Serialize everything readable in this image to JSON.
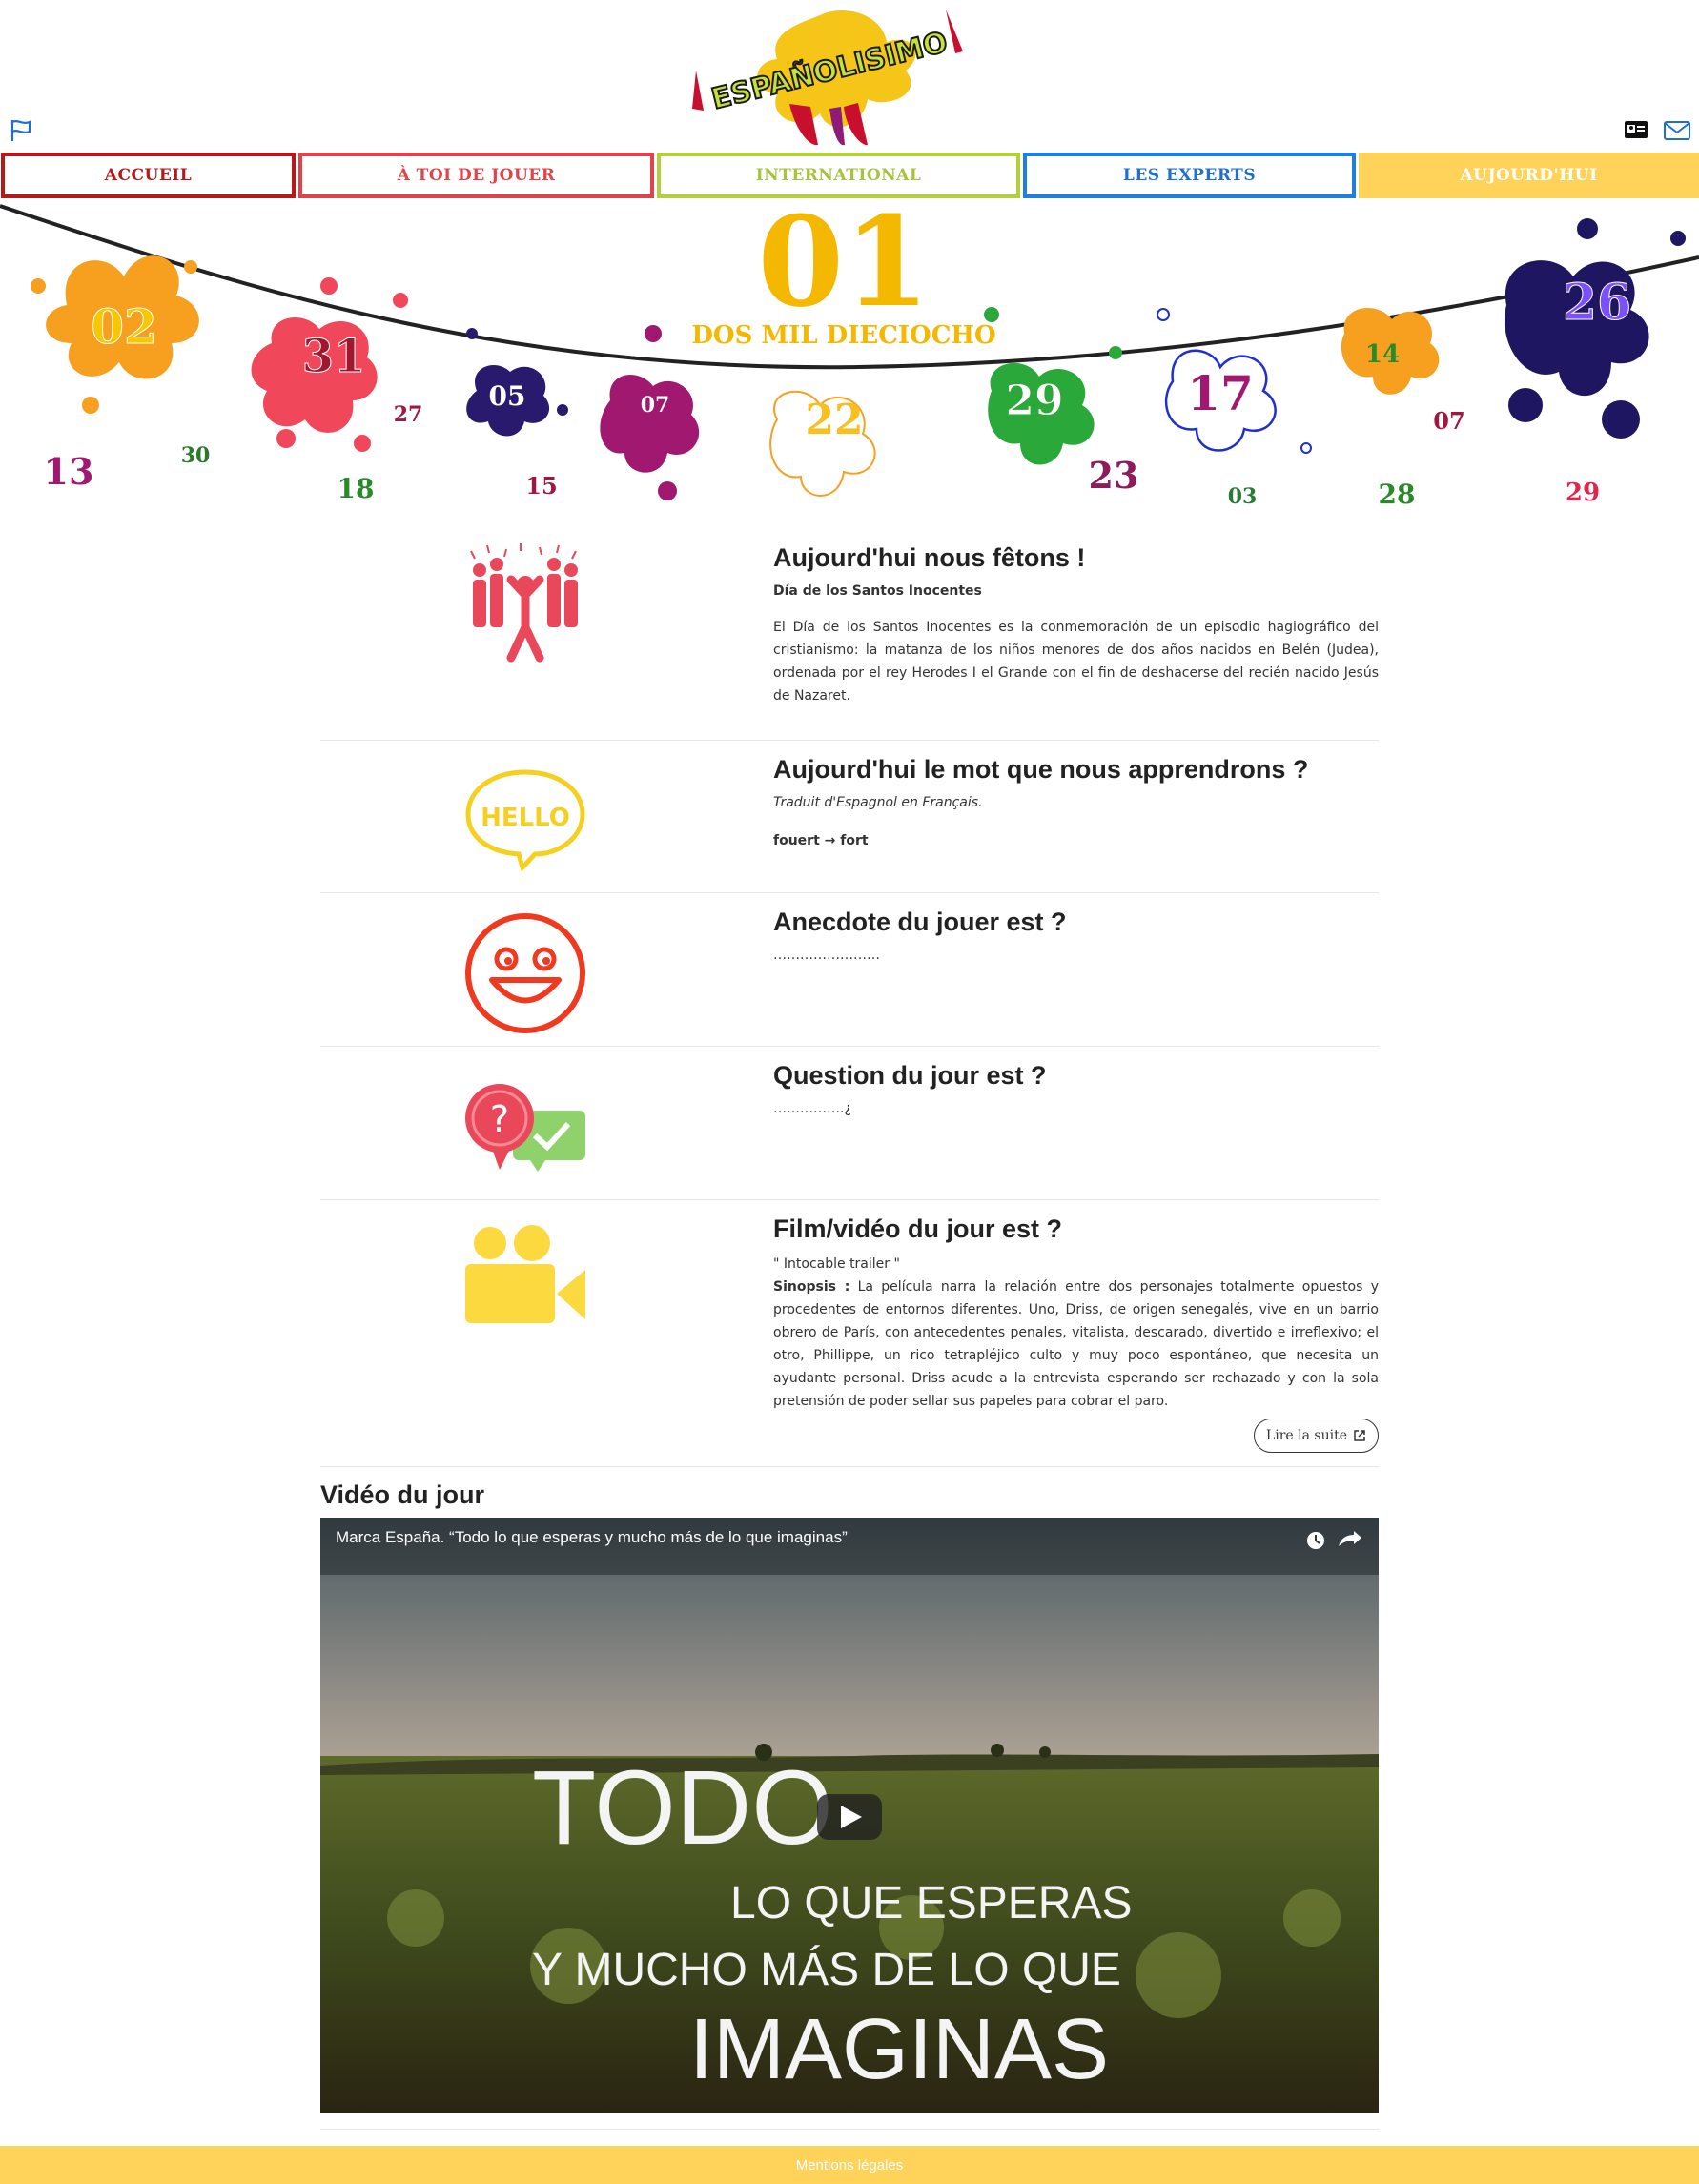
{
  "header": {
    "logo_text": "ESPAÑOLISIMO",
    "flag_icon": "flag-icon",
    "card_icon": "id-card-icon",
    "mail_icon": "envelope-icon"
  },
  "nav": {
    "items": [
      {
        "label": "ACCUEIL"
      },
      {
        "label": "À TOI DE JOUER"
      },
      {
        "label": "INTERNATIONAL"
      },
      {
        "label": "LES EXPERTS"
      },
      {
        "label": "AUJOURD'HUI"
      }
    ]
  },
  "banner": {
    "day": "01",
    "year_text": "DOS MIL DIECIOCHO",
    "numbers": [
      "02",
      "31",
      "27",
      "05",
      "07",
      "22",
      "29",
      "17",
      "14",
      "26",
      "13",
      "30",
      "18",
      "15",
      "23",
      "03",
      "28",
      "07",
      "29"
    ]
  },
  "sections": [
    {
      "title": "Aujourd'hui nous fêtons !",
      "subtitle": "Día de los Santos Inocentes",
      "text": "El Día de los Santos Inocentes es la conmemoración de un episodio hagiográfico del cristianismo: la matanza de los niños menores de dos años nacidos en Belén (Judea), ordenada por el rey Herodes I el Grande con el fin de deshacerse del recién nacido Jesús de Nazaret.",
      "icon": "celebration-crowd-icon"
    },
    {
      "title": "Aujourd'hui le mot que nous apprendrons ?",
      "subtitle": "Traduit d'Espagnol en Français.",
      "text": "fouert → fort",
      "icon": "hello-speech-bubble-icon",
      "icon_text": "HELLO"
    },
    {
      "title": "Anecdote du jouer est ?",
      "text": "……………………",
      "icon": "smiley-face-icon"
    },
    {
      "title": "Question du jour est ?",
      "text": "…………….¿",
      "icon": "question-check-bubbles-icon"
    },
    {
      "title": "Film/vidéo du jour est ?",
      "subtitle": "\" Intocable trailer \"",
      "label": "Sinopsis :",
      "text": "La película narra la relación entre dos personajes totalmente opuestos y procedentes de entornos diferentes. Uno, Driss, de origen senegalés, vive en un barrio obrero de París, con antecedentes penales, vitalista, descarado, divertido e irreflexivo; el otro, Phillippe, un rico tetrapléjico culto y muy poco espontáneo, que necesita un ayudante personal. Driss acude a la entrevista esperando ser rechazado y con la sola pretensión de poder sellar sus papeles para cobrar el paro.",
      "button": "Lire la suite",
      "icon": "video-camera-icon"
    }
  ],
  "video": {
    "heading": "Vidéo du jour",
    "title": "Marca España. “Todo lo que esperas y mucho más de lo que imaginas”",
    "overlay_lines": [
      "TODO",
      "LO QUE ESPERAS",
      "Y MUCHO MÁS DE LO QUE",
      "IMAGINAS"
    ]
  },
  "footer": {
    "link": "Mentions légales"
  },
  "colors": {
    "yellow": "#ffd35a",
    "red": "#b51a1a",
    "coral": "#e0434a",
    "lime": "#b4cf3c",
    "blue": "#1f7fe0"
  }
}
